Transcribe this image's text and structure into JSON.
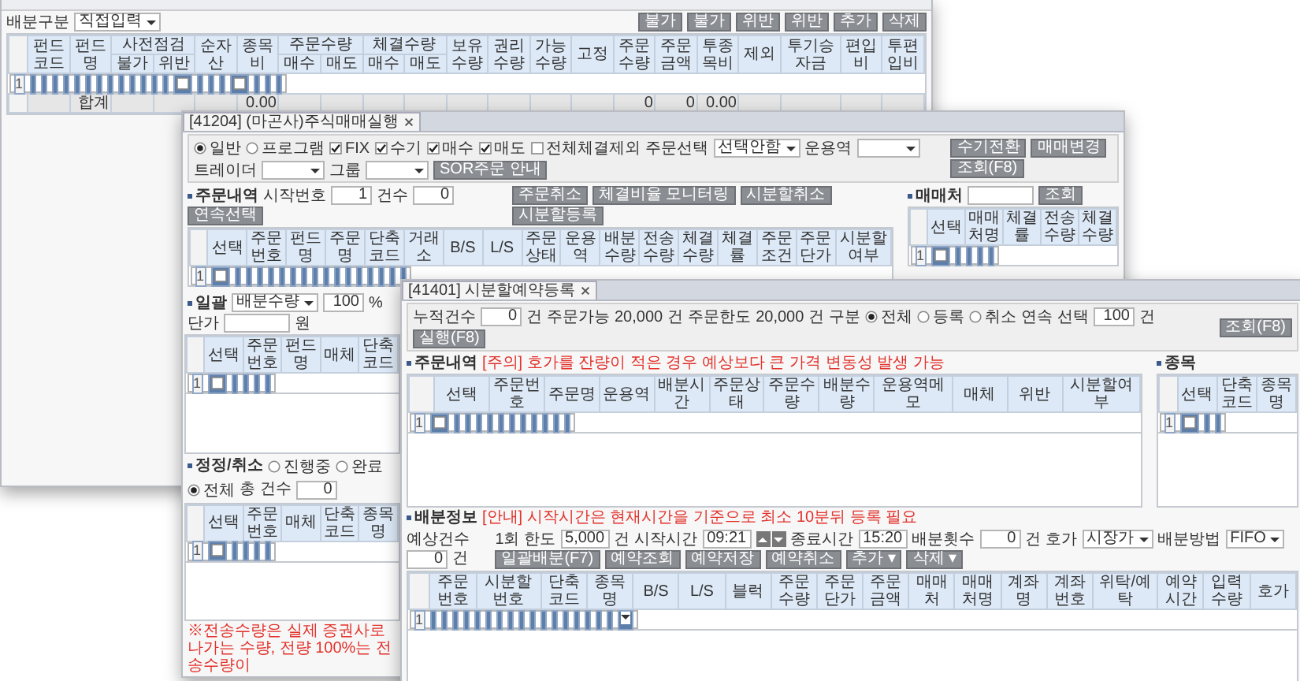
{
  "back_window": {
    "bar": {
      "left": [
        {
          "kind": "label",
          "text": "배분구분"
        },
        {
          "kind": "select",
          "value": "직접입력"
        }
      ],
      "right": [
        {
          "kind": "button",
          "text": "불가"
        },
        {
          "kind": "button",
          "text": "불가"
        },
        {
          "kind": "button",
          "text": "위반"
        },
        {
          "kind": "button",
          "text": "위반"
        },
        {
          "kind": "button",
          "text": "추가"
        },
        {
          "kind": "button",
          "text": "삭제"
        }
      ]
    },
    "grid": {
      "columns": [
        {
          "kind": "input",
          "label": "펀드코드"
        },
        {
          "kind": "text",
          "label": "펀드명",
          "total": "합계"
        },
        {
          "kind": "group",
          "label": "사전점검",
          "children": [
            {
              "label": "불가"
            },
            {
              "label": "위반"
            }
          ]
        },
        {
          "kind": "text",
          "label": "순자산"
        },
        {
          "kind": "text",
          "label": "종목비",
          "total": "0.00"
        },
        {
          "kind": "group",
          "label": "주문수량",
          "children": [
            {
              "label": "매수"
            },
            {
              "label": "매도"
            }
          ]
        },
        {
          "kind": "group",
          "label": "체결수량",
          "children": [
            {
              "label": "매수"
            },
            {
              "label": "매도"
            }
          ]
        },
        {
          "kind": "text",
          "label": "보유수량"
        },
        {
          "kind": "text",
          "label": "권리수량"
        },
        {
          "kind": "text",
          "label": "가능수량"
        },
        {
          "kind": "check",
          "label": "고정"
        },
        {
          "kind": "input",
          "label": "주문수량",
          "total": "0"
        },
        {
          "kind": "text",
          "label": "주문금액",
          "total": "0"
        },
        {
          "kind": "input",
          "label": "투종목비",
          "total": "0.00"
        },
        {
          "kind": "check",
          "label": "제외"
        },
        {
          "kind": "text",
          "label": "투기승자금"
        },
        {
          "kind": "text",
          "label": "편입비"
        },
        {
          "kind": "text",
          "label": "투편입비"
        }
      ],
      "rows": [
        {
          "number": "1",
          "selected": true,
          "checked": false
        }
      ]
    }
  },
  "order_window": {
    "tab": "[41204] (마곤사)주식매매실행",
    "options": {
      "left": [
        {
          "kind": "radio",
          "text": "일반",
          "selected": true
        },
        {
          "kind": "radio",
          "text": "프로그램",
          "selected": false
        },
        {
          "kind": "check",
          "text": "FIX",
          "checked": true
        },
        {
          "kind": "check",
          "text": "수기",
          "checked": true
        },
        {
          "kind": "check",
          "text": "매수",
          "checked": true
        },
        {
          "kind": "check",
          "text": "매도",
          "checked": true
        },
        {
          "kind": "check",
          "text": "전체체결제외",
          "checked": false
        },
        {
          "kind": "label",
          "text": "주문선택"
        },
        {
          "kind": "select",
          "value": "선택안함"
        },
        {
          "kind": "label",
          "text": "운용역"
        },
        {
          "kind": "select"
        },
        {
          "kind": "label",
          "text": "트레이더"
        },
        {
          "kind": "select"
        },
        {
          "kind": "label",
          "text": "그룹"
        },
        {
          "kind": "select"
        },
        {
          "kind": "button",
          "text": "SOR주문 안내"
        }
      ],
      "right": [
        {
          "kind": "button",
          "text": "수기전환"
        },
        {
          "kind": "button",
          "text": "매매변경"
        },
        {
          "kind": "button",
          "text": "조회(F8)"
        }
      ]
    },
    "orders": {
      "bar": {
        "left": [
          {
            "kind": "section",
            "text": "주문내역"
          },
          {
            "kind": "label",
            "text": "시작번호"
          },
          {
            "kind": "input",
            "value": "1"
          },
          {
            "kind": "label",
            "text": "건수"
          },
          {
            "kind": "input",
            "value": "0"
          },
          {
            "kind": "button",
            "text": "연속선택"
          }
        ],
        "right": [
          {
            "kind": "button",
            "text": "주문취소"
          },
          {
            "kind": "button",
            "text": "체결비율 모니터링"
          },
          {
            "kind": "button",
            "text": "시분할취소"
          },
          {
            "kind": "button",
            "text": "시분할등록"
          }
        ]
      },
      "grid": {
        "columns": [
          {
            "kind": "check",
            "label": "선택"
          },
          {
            "kind": "text",
            "label": "주문번호"
          },
          {
            "kind": "text",
            "label": "펀드명"
          },
          {
            "kind": "text",
            "label": "주문명"
          },
          {
            "kind": "text",
            "label": "단축코드"
          },
          {
            "kind": "text",
            "label": "거래소"
          },
          {
            "kind": "text",
            "label": "B/S"
          },
          {
            "kind": "text",
            "label": "L/S"
          },
          {
            "kind": "text",
            "label": "주문상태"
          },
          {
            "kind": "text",
            "label": "운용역"
          },
          {
            "kind": "text",
            "label": "배분수량"
          },
          {
            "kind": "text",
            "label": "전송수량"
          },
          {
            "kind": "text",
            "label": "체결수량"
          },
          {
            "kind": "text",
            "label": "체결률"
          },
          {
            "kind": "text",
            "label": "주문조건"
          },
          {
            "kind": "text",
            "label": "주문단가"
          },
          {
            "kind": "text",
            "label": "시분할여부"
          }
        ],
        "rows": [
          {
            "number": "1",
            "selected": true,
            "checked": false
          }
        ]
      }
    },
    "brokers": {
      "bar": {
        "left": [
          {
            "kind": "section",
            "text": "매매처"
          },
          {
            "kind": "input"
          },
          {
            "kind": "button",
            "text": "조회"
          }
        ]
      },
      "grid": {
        "columns": [
          {
            "kind": "check",
            "label": "선택"
          },
          {
            "kind": "text",
            "label": "매매처명"
          },
          {
            "kind": "text",
            "label": "체결률"
          },
          {
            "kind": "text",
            "label": "전송수량"
          },
          {
            "kind": "text",
            "label": "체결수량"
          }
        ],
        "rows": [
          {
            "number": "1",
            "selected": true,
            "checked": false
          }
        ]
      }
    },
    "bulk": {
      "bar": {
        "left": [
          {
            "kind": "section",
            "text": "일괄"
          },
          {
            "kind": "select",
            "value": "배분수량"
          },
          {
            "kind": "input",
            "value": "100"
          },
          {
            "kind": "label",
            "text": "%"
          },
          {
            "kind": "label",
            "text": "단가"
          },
          {
            "kind": "input"
          },
          {
            "kind": "label",
            "text": "원"
          }
        ]
      },
      "grid": {
        "columns": [
          {
            "kind": "check",
            "label": "선택"
          },
          {
            "kind": "text",
            "label": "주문번호"
          },
          {
            "kind": "text",
            "label": "펀드명"
          },
          {
            "kind": "text",
            "label": "매체"
          },
          {
            "kind": "text",
            "label": "단축코드"
          }
        ],
        "rows": [
          {
            "number": "1",
            "selected": true,
            "checked": false
          }
        ]
      }
    },
    "amend": {
      "bar": {
        "left": [
          {
            "kind": "section",
            "text": "정정/취소"
          },
          {
            "kind": "radio",
            "text": "진행중",
            "selected": false
          },
          {
            "kind": "radio",
            "text": "완료",
            "selected": false
          },
          {
            "kind": "radio",
            "text": "전체",
            "selected": true
          },
          {
            "kind": "label",
            "text": "총 건수"
          },
          {
            "kind": "input",
            "value": "0"
          }
        ]
      },
      "grid": {
        "columns": [
          {
            "kind": "check",
            "label": "선택"
          },
          {
            "kind": "text",
            "label": "주문번호"
          },
          {
            "kind": "text",
            "label": "매체"
          },
          {
            "kind": "text",
            "label": "단축코드"
          },
          {
            "kind": "text",
            "label": "종목명"
          }
        ],
        "rows": [
          {
            "number": "1",
            "selected": true,
            "checked": false
          }
        ]
      }
    },
    "footer": "※전송수량은 실제 증권사로 나가는 수량, 전량 100%는 전송수량이"
  },
  "schedule_window": {
    "tab": "[41401] 시분할예약등록",
    "options": {
      "left": [
        {
          "kind": "label",
          "text": "누적건수"
        },
        {
          "kind": "input",
          "value": "0"
        },
        {
          "kind": "label",
          "text": "건"
        },
        {
          "kind": "label",
          "text": "주문가능"
        },
        {
          "kind": "label",
          "text": "20,000"
        },
        {
          "kind": "label",
          "text": "건"
        },
        {
          "kind": "label",
          "text": "주문한도"
        },
        {
          "kind": "label",
          "text": "20,000"
        },
        {
          "kind": "label",
          "text": "건"
        },
        {
          "kind": "label",
          "text": "구분"
        },
        {
          "kind": "radio",
          "text": "전체",
          "selected": true
        },
        {
          "kind": "radio",
          "text": "등록",
          "selected": false
        },
        {
          "kind": "radio",
          "text": "취소",
          "selected": false
        },
        {
          "kind": "label",
          "text": "연속 선택"
        },
        {
          "kind": "input",
          "value": "100"
        },
        {
          "kind": "label",
          "text": "건"
        },
        {
          "kind": "button",
          "text": "실행(F8)"
        }
      ],
      "right": [
        {
          "kind": "button",
          "text": "조회(F8)"
        }
      ]
    },
    "orders": {
      "bar": {
        "left": [
          {
            "kind": "section",
            "text": "주문내역"
          },
          {
            "kind": "note",
            "text": "[주의] 호가를 잔량이 적은 경우 예상보다 큰 가격 변동성 발생 가능"
          }
        ]
      },
      "grid": {
        "columns": [
          {
            "kind": "check",
            "label": "선택"
          },
          {
            "kind": "text",
            "label": "주문번호"
          },
          {
            "kind": "text",
            "label": "주문명"
          },
          {
            "kind": "text",
            "label": "운용역"
          },
          {
            "kind": "text",
            "label": "배분시간"
          },
          {
            "kind": "text",
            "label": "주문상태"
          },
          {
            "kind": "text",
            "label": "주문수량"
          },
          {
            "kind": "text",
            "label": "배분수량"
          },
          {
            "kind": "text",
            "label": "운용역메모"
          },
          {
            "kind": "text",
            "label": "매체"
          },
          {
            "kind": "text",
            "label": "위반"
          },
          {
            "kind": "text",
            "label": "시분할여부"
          }
        ],
        "rows": [
          {
            "number": "1",
            "selected": true,
            "checked": false
          }
        ]
      }
    },
    "stocks": {
      "bar": {
        "left": [
          {
            "kind": "section",
            "text": "종목"
          }
        ]
      },
      "grid": {
        "columns": [
          {
            "kind": "check",
            "label": "선택"
          },
          {
            "kind": "text",
            "label": "단축코드"
          },
          {
            "kind": "text",
            "label": "종목명"
          }
        ],
        "rows": [
          {
            "number": "1",
            "selected": true,
            "checked": false
          }
        ]
      }
    },
    "distribution": {
      "bar": {
        "left": [
          {
            "kind": "section",
            "text": "배분정보"
          },
          {
            "kind": "note",
            "text": "[안내] 시작시간은 현재시간을 기준으로 최소 10분뒤 등록 필요"
          }
        ]
      },
      "settings": {
        "left": [
          {
            "kind": "label",
            "text": "예상건수"
          },
          {
            "kind": "input",
            "value": "0"
          },
          {
            "kind": "label",
            "text": "건"
          }
        ],
        "right": [
          {
            "kind": "label",
            "text": "1회 한도"
          },
          {
            "kind": "input",
            "value": "5,000"
          },
          {
            "kind": "label",
            "text": "건"
          },
          {
            "kind": "label",
            "text": "시작시간"
          },
          {
            "kind": "input",
            "value": "09:21"
          },
          {
            "kind": "spin"
          },
          {
            "kind": "label",
            "text": "종료시간"
          },
          {
            "kind": "input",
            "value": "15:20"
          },
          {
            "kind": "label",
            "text": "배분횟수"
          },
          {
            "kind": "input",
            "value": "0"
          },
          {
            "kind": "label",
            "text": "건"
          },
          {
            "kind": "label",
            "text": "호가"
          },
          {
            "kind": "select",
            "value": "시장가"
          },
          {
            "kind": "label",
            "text": "배분방법"
          },
          {
            "kind": "select",
            "value": "FIFO"
          },
          {
            "kind": "button",
            "text": "일괄배분(F7)"
          },
          {
            "kind": "button",
            "text": "예약조회"
          },
          {
            "kind": "button",
            "text": "예약저장"
          },
          {
            "kind": "button",
            "text": "예약취소"
          },
          {
            "kind": "button",
            "text": "추가 ▾"
          },
          {
            "kind": "button",
            "text": "삭제 ▾"
          }
        ]
      },
      "grid": {
        "columns": [
          {
            "kind": "text",
            "label": "주문번호"
          },
          {
            "kind": "text",
            "label": "시분할번호"
          },
          {
            "kind": "text",
            "label": "단축코드"
          },
          {
            "kind": "text",
            "label": "종목명"
          },
          {
            "kind": "text",
            "label": "B/S"
          },
          {
            "kind": "text",
            "label": "L/S"
          },
          {
            "kind": "text",
            "label": "블럭"
          },
          {
            "kind": "text",
            "label": "주문수량"
          },
          {
            "kind": "text",
            "label": "주문단가"
          },
          {
            "kind": "text",
            "label": "주문금액"
          },
          {
            "kind": "text",
            "label": "매매처"
          },
          {
            "kind": "text",
            "label": "매매처명"
          },
          {
            "kind": "text",
            "label": "계좌명"
          },
          {
            "kind": "text",
            "label": "계좌번호"
          },
          {
            "kind": "text",
            "label": "위탁/예탁"
          },
          {
            "kind": "input",
            "label": "예약시간"
          },
          {
            "kind": "input",
            "label": "입력수량"
          },
          {
            "kind": "select",
            "label": "호가"
          }
        ],
        "rows": [
          {
            "number": "1",
            "selected": true
          }
        ]
      }
    }
  }
}
